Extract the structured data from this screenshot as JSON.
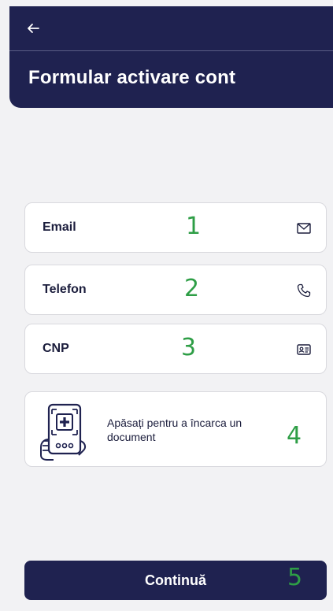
{
  "header": {
    "back_icon": "arrow-left-icon",
    "title": "Formular activare cont"
  },
  "fields": [
    {
      "label": "Email",
      "num": "1",
      "icon": "envelope-icon"
    },
    {
      "label": "Telefon",
      "num": "2",
      "icon": "phone-icon"
    },
    {
      "label": "CNP",
      "num": "3",
      "icon": "id-card-icon"
    }
  ],
  "upload": {
    "text": "Apăsați pentru a încarca un document",
    "num": "4",
    "icon": "document-upload-icon"
  },
  "footer": {
    "continue_label": "Continuă",
    "num": "5"
  },
  "colors": {
    "primary": "#1f2250",
    "background": "#f2f2f4",
    "annotation": "#2e9e46"
  }
}
